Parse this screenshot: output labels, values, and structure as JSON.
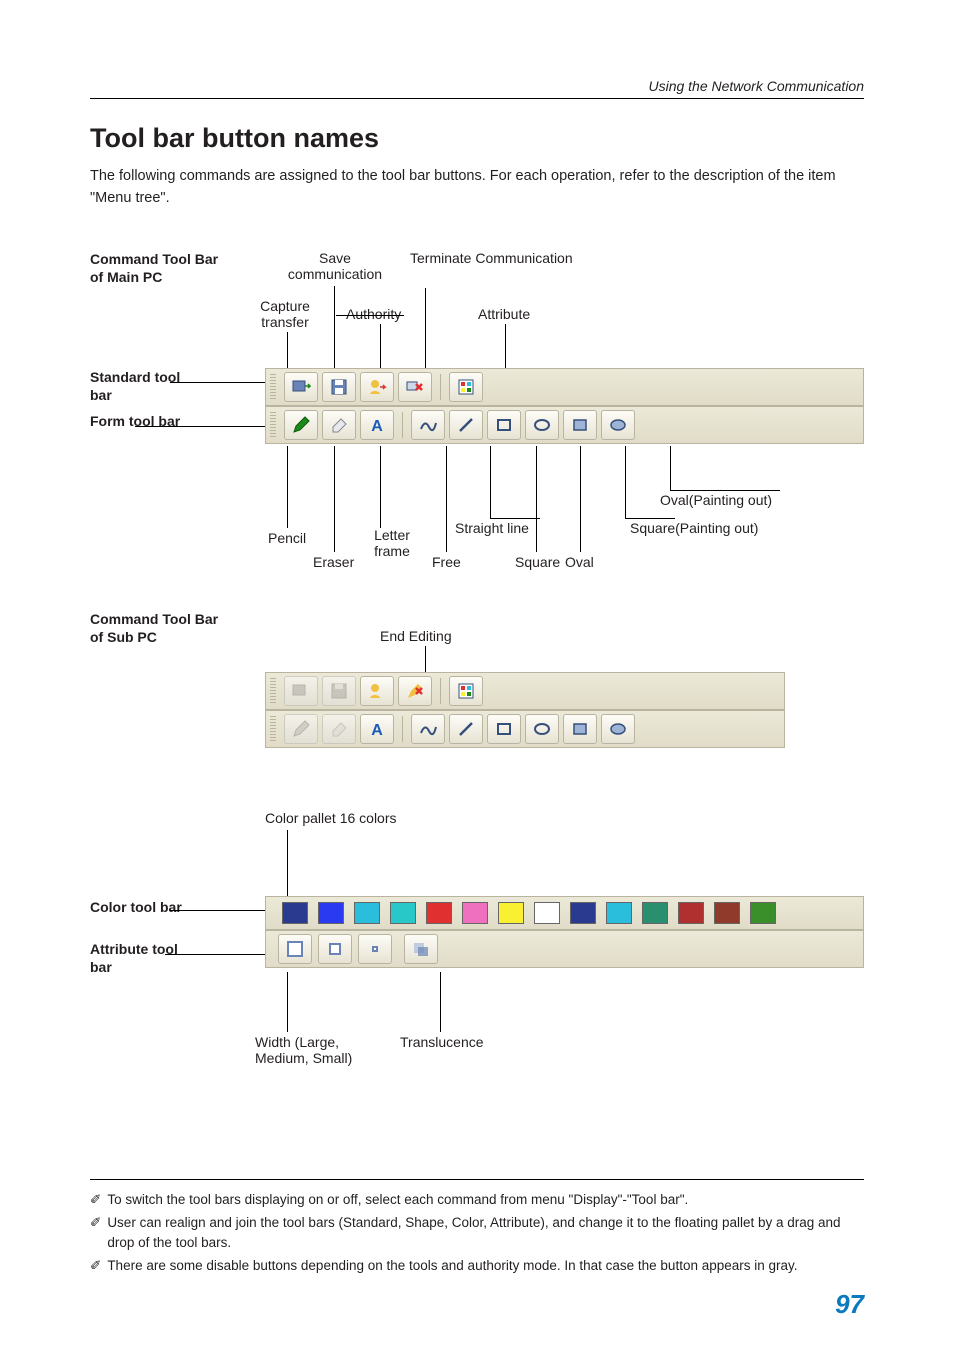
{
  "header": {
    "section": "Using the Network Communication"
  },
  "title": "Tool bar button names",
  "intro": "The following commands are assigned to the tool bar buttons. For each operation, refer to the description of the item \"Menu tree\".",
  "sec1": {
    "sideTop": "Command Tool Bar of Main PC",
    "labels": {
      "save": "Save communication",
      "capture": "Capture transfer",
      "authority": "Authority",
      "terminate": "Terminate Communication",
      "attribute": "Attribute",
      "standard": "Standard tool bar",
      "form": "Form tool bar",
      "pencil": "Pencil",
      "eraser": "Eraser",
      "letter": "Letter frame",
      "free": "Free",
      "straight": "Straight line",
      "square": "Square",
      "oval": "Oval",
      "sqpaint": "Square(Painting out)",
      "ovpaint": "Oval(Painting out)"
    }
  },
  "sec2": {
    "sideTop": "Command Tool Bar of Sub PC",
    "endEdit": "End Editing"
  },
  "sec3": {
    "pallet": "Color pallet 16 colors",
    "colorLabel": "Color tool bar",
    "attrLabel": "Attribute tool bar",
    "width": "Width (Large, Medium, Small)",
    "trans": "Translucence",
    "colors": [
      "#2a3a8f",
      "#2a3af0",
      "#2abedc",
      "#28c8c8",
      "#e03030",
      "#f070c0",
      "#f8f030",
      "#ffffff",
      "#2a3a8f",
      "#2abedc",
      "#2a8f6f",
      "#b03030",
      "#8f3a2a",
      "#3a8f2a"
    ]
  },
  "notes": [
    "To switch the tool bars displaying on or off, select each command from menu  \"Display\"-\"Tool bar\".",
    "User can realign and join the tool bars (Standard, Shape, Color, Attribute), and change it to the floating pallet by a drag and drop of the tool bars.",
    "There are some disable buttons depending on the tools and authority mode. In that case the button appears in gray."
  ],
  "pageNumber": "97"
}
